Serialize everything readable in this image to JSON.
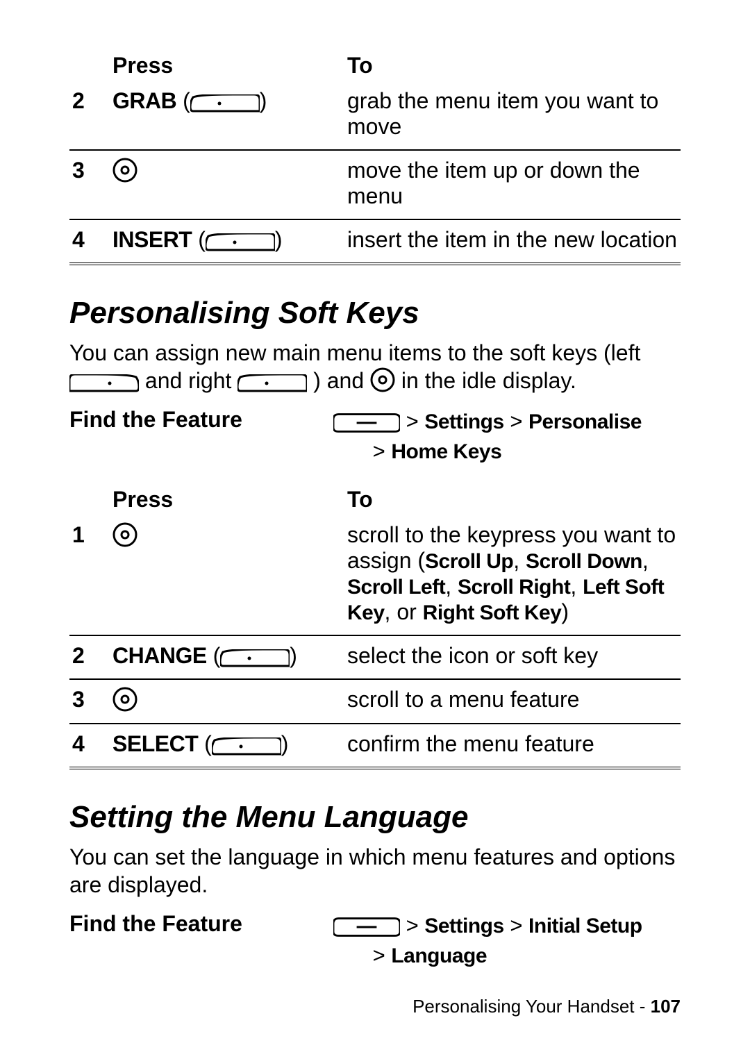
{
  "table1": {
    "head_press": "Press",
    "head_to": "To",
    "rows": [
      {
        "n": "2",
        "press_label": "GRAB",
        "press_icon": "softkey-right",
        "to": "grab the menu item you want to move"
      },
      {
        "n": "3",
        "press_label": "",
        "press_icon": "navdisc",
        "to": "move the item up or down the menu"
      },
      {
        "n": "4",
        "press_label": "INSERT",
        "press_icon": "softkey-right",
        "to": "insert the item in the new location"
      }
    ]
  },
  "section1": {
    "title": "Personalising Soft Keys",
    "para_a": "You can assign new main menu items to the soft keys (left ",
    "para_b": " and right ",
    "para_c": ") and ",
    "para_d": " in the idle display.",
    "find_label": "Find the Feature",
    "path_prefix": " > ",
    "path_l1_a": "Settings",
    "path_l1_sep": " > ",
    "path_l1_b": "Personalise",
    "path_l2_prefix": "> ",
    "path_l2": "Home Keys"
  },
  "table2": {
    "head_press": "Press",
    "head_to": "To",
    "rows": [
      {
        "n": "1",
        "press_label": "",
        "press_icon": "navdisc",
        "to_a": "scroll to the keypress you want to assign (",
        "opt1": "Scroll Up",
        "c1": ", ",
        "opt2": "Scroll Down",
        "c2": ", ",
        "opt3": "Scroll Left",
        "c3": ",  ",
        "opt4": "Scroll Right",
        "c4": ", ",
        "opt5": "Left Soft Key",
        "c5": ", or ",
        "opt6": "Right Soft Key",
        "to_b": ")"
      },
      {
        "n": "2",
        "press_label": "CHANGE",
        "press_icon": "softkey-right",
        "to": "select the icon or soft key"
      },
      {
        "n": "3",
        "press_label": "",
        "press_icon": "navdisc",
        "to": "scroll to a menu feature"
      },
      {
        "n": "4",
        "press_label": "SELECT",
        "press_icon": "softkey-right",
        "to": "confirm the menu feature"
      }
    ]
  },
  "section2": {
    "title": "Setting the Menu Language",
    "para": "You can set the language in which menu features and options are displayed.",
    "find_label": "Find the Feature",
    "path_prefix": " > ",
    "path_l1_a": "Settings",
    "path_l1_sep": " > ",
    "path_l1_b": "Initial Setup",
    "path_l2_prefix": "> ",
    "path_l2": "Language"
  },
  "footer": {
    "text": "Personalising Your Handset - ",
    "page": "107"
  }
}
